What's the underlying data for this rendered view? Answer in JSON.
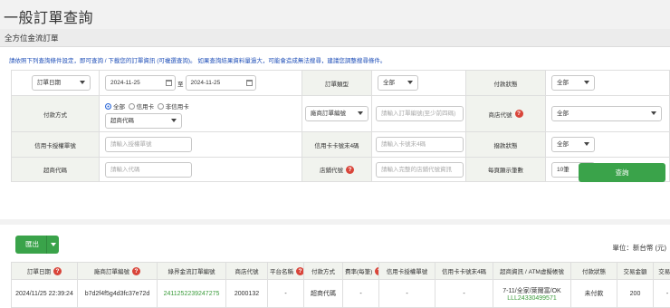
{
  "page": {
    "title": "一般訂單查詢"
  },
  "section": {
    "title": "全方位金流訂單"
  },
  "instructions": "請依照下列查詢條件設定，即可查詢 / 下載您的訂單資訊 (可複選查詢)。 如果查詢結果資料量過大，可能會造成無法搜尋，建議您調整搜尋條件。",
  "filters": {
    "date_type": "訂單日期",
    "date_from": "2024-11-25",
    "date_to_label": "至",
    "date_to": "2024-11-25",
    "order_type_label": "訂單類型",
    "order_type_value": "全部",
    "payment_status_label": "付款狀態",
    "payment_status_value": "全部",
    "payment_method_label": "付款方式",
    "radio_all": "全部",
    "radio_credit": "信用卡",
    "radio_noncredit": "非信用卡",
    "payment_sub_value": "超商代碼",
    "order_no_type": "廠商訂單編號",
    "order_no_placeholder": "請輸入訂單編號(至少前四碼)",
    "store_id_label": "商店代號",
    "store_id_value": "全部",
    "card_auth_label": "信用卡授權單號",
    "card_auth_placeholder": "請輸入授權單號",
    "card_last4_label": "信用卡卡號末4碼",
    "card_last4_placeholder": "請輸入卡號末4碼",
    "appropriation_label": "撥款狀態",
    "appropriation_value": "全部",
    "cvs_code_label": "超商代碼",
    "cvs_code_placeholder": "請輸入代碼",
    "branch_no_label": "店鋪代號",
    "branch_no_placeholder": "請輸入完整的店鋪代號資訊",
    "page_size_label": "每頁顯示筆數",
    "page_size_value": "10筆"
  },
  "actions": {
    "query": "查詢",
    "export": "匯出"
  },
  "results": {
    "unit": "單位：新台幣 (元)",
    "columns": [
      "訂單日期",
      "廠商訂單編號",
      "綠界金流訂單編號",
      "商店代號",
      "平台名稱",
      "付款方式",
      "費率(每筆)",
      "信用卡授權單號",
      "信用卡卡號末4碼",
      "超商資訊 / ATM虛擬帳號",
      "付款狀態",
      "交易金額",
      "交易手"
    ],
    "row": {
      "order_date": "2024/11/25 22:39:24",
      "merchant_order_no": "b7d2f4f5g4d3fc37e72d",
      "ecpay_order_no": "2411252239247275",
      "store_id": "2000132",
      "platform": "-",
      "payment_method": "超商代碼",
      "fee": "-",
      "card_auth": "-",
      "card_last4": "-",
      "cvs_info_line1": "7-11/全家/萊爾富/OK",
      "cvs_info_line2": "LLL24330499571",
      "payment_status": "未付款",
      "amount": "200",
      "fee_cut": "-"
    }
  },
  "colors": {
    "accent_green": "#3aa34a",
    "help_red": "#d9453a",
    "link_blue": "#1f4fb8"
  }
}
